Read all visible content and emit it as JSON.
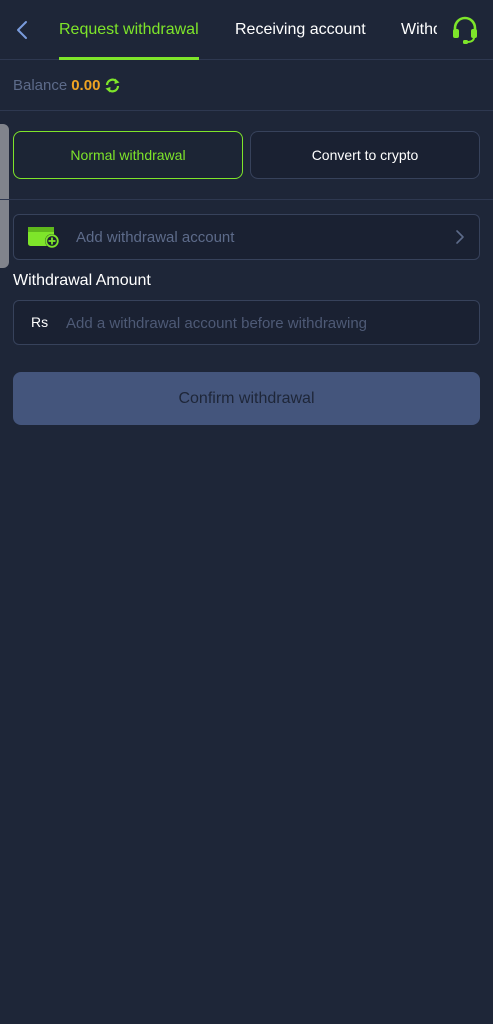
{
  "header": {
    "tabs": [
      {
        "label": "Request withdrawal",
        "active": true
      },
      {
        "label": "Receiving account",
        "active": false
      },
      {
        "label": "Withdrawal history",
        "active": false
      }
    ],
    "back_icon": "chevron-left-icon",
    "support_icon": "headset-icon"
  },
  "balance": {
    "label": "Balance",
    "value": "0.00",
    "refresh_icon": "refresh-icon"
  },
  "modes": {
    "normal_label": "Normal withdrawal",
    "crypto_label": "Convert to crypto",
    "selected": "normal"
  },
  "account": {
    "add_label": "Add withdrawal account",
    "icon": "wallet-add-icon"
  },
  "amount": {
    "title": "Withdrawal Amount",
    "currency": "Rs",
    "placeholder": "Add a withdrawal account before withdrawing",
    "value": ""
  },
  "confirm": {
    "label": "Confirm withdrawal"
  },
  "colors": {
    "background": "#1e2638",
    "accent": "#7ee52a",
    "balance": "#f0a422",
    "muted": "#5d6b8a",
    "confirm_bg": "#44557c"
  }
}
